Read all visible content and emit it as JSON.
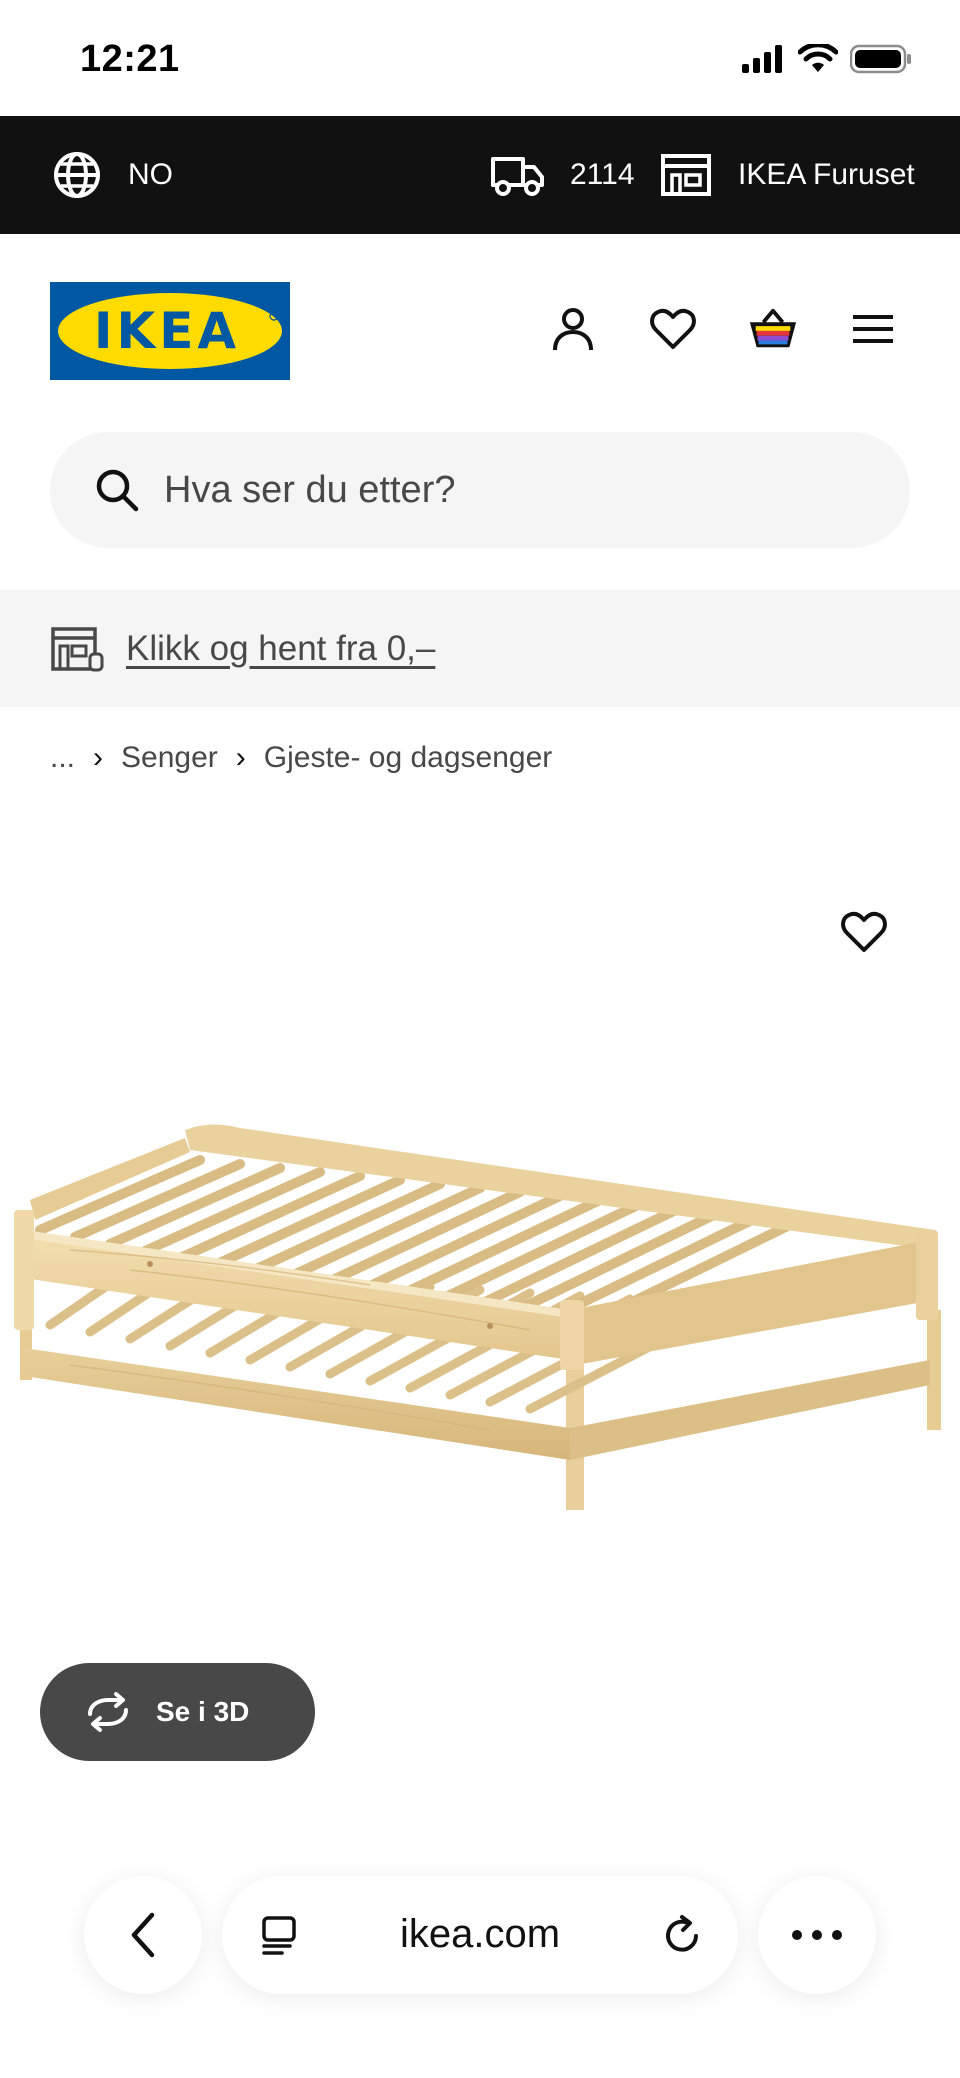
{
  "status_bar": {
    "time": "12:21"
  },
  "top_bar": {
    "locale": "NO",
    "postal_code": "2114",
    "store": "IKEA Furuset"
  },
  "header": {
    "logo_text": "IKEA",
    "icons": [
      "user-icon",
      "heart-icon",
      "basket-icon",
      "menu-icon"
    ]
  },
  "search": {
    "placeholder": "Hva ser du etter?"
  },
  "promo": {
    "link_text": "Klikk og hent fra 0,–"
  },
  "breadcrumb": {
    "ellipsis": "...",
    "items": [
      "Senger",
      "Gjeste- og dagsenger"
    ]
  },
  "product": {
    "view_3d_label": "Se i 3D"
  },
  "browser": {
    "url": "ikea.com"
  },
  "colors": {
    "ikea_blue": "#0058a3",
    "ikea_yellow": "#ffdb00",
    "top_bar_bg": "#111111",
    "button_dark": "#484848"
  }
}
